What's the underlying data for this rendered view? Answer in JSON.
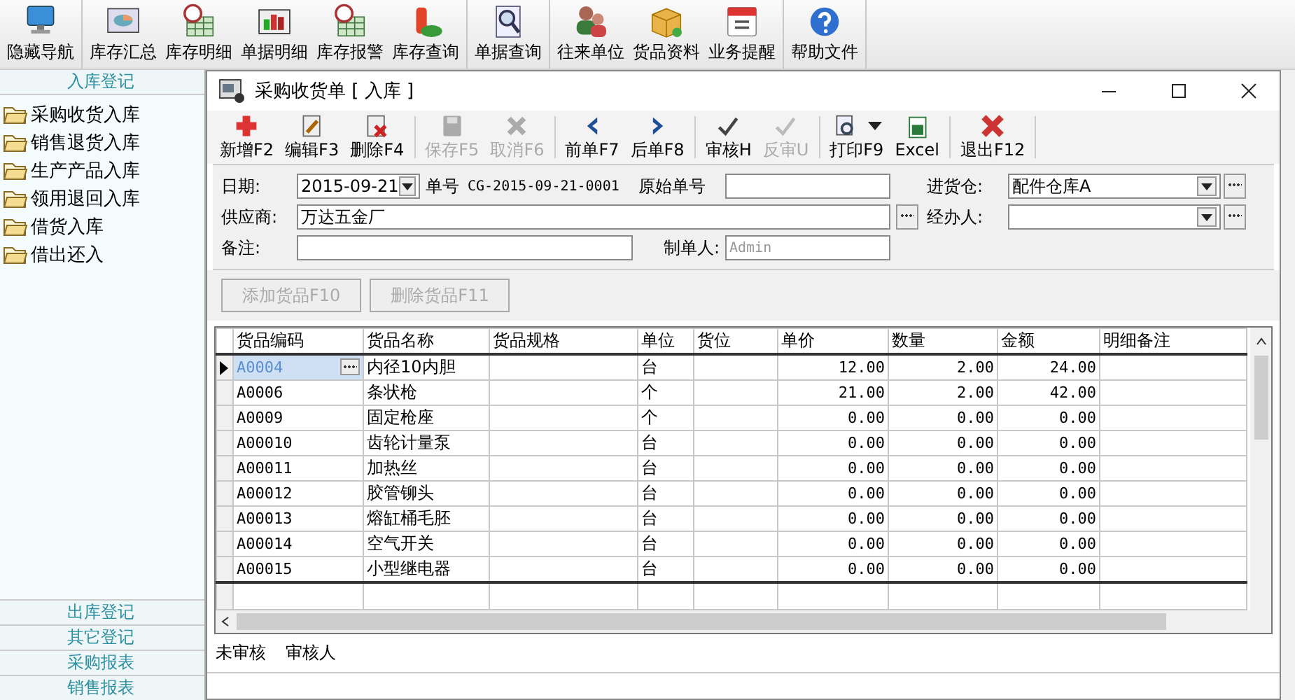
{
  "main_toolbar": [
    {
      "buttons": [
        "隐藏导航"
      ]
    },
    {
      "buttons": [
        "库存汇总",
        "库存明细",
        "单据明细",
        "库存报警",
        "库存查询"
      ]
    },
    {
      "buttons": [
        "单据查询"
      ]
    },
    {
      "buttons": [
        "往来单位",
        "货品资料",
        "业务提醒"
      ]
    },
    {
      "buttons": [
        "帮助文件"
      ]
    }
  ],
  "sidebar": {
    "header": "入库登记",
    "items": [
      {
        "label": "采购收货入库",
        "selected": false
      },
      {
        "label": "销售退货入库",
        "selected": false
      },
      {
        "label": "生产产品入库",
        "selected": false
      },
      {
        "label": "领用退回入库",
        "selected": false
      },
      {
        "label": "借货入库",
        "selected": false
      },
      {
        "label": "借出还入",
        "selected": false
      }
    ],
    "sections": [
      "出库登记",
      "其它登记",
      "采购报表",
      "销售报表"
    ]
  },
  "window": {
    "title": "采购收货单 [ 入库 ]"
  },
  "toolbar": [
    {
      "buttons": [
        {
          "label": "新增F2",
          "disabled": false,
          "has_menu": false
        },
        {
          "label": "编辑F3",
          "disabled": false,
          "has_menu": false
        },
        {
          "label": "删除F4",
          "disabled": false,
          "has_menu": false
        }
      ]
    },
    {
      "buttons": [
        {
          "label": "保存F5",
          "disabled": true,
          "has_menu": false
        },
        {
          "label": "取消F6",
          "disabled": true,
          "has_menu": false
        }
      ]
    },
    {
      "buttons": [
        {
          "label": "前单F7",
          "disabled": false,
          "has_menu": false
        },
        {
          "label": "后单F8",
          "disabled": false,
          "has_menu": false
        }
      ]
    },
    {
      "buttons": [
        {
          "label": "审核H",
          "disabled": false,
          "has_menu": false
        },
        {
          "label": "反审U",
          "disabled": true,
          "has_menu": false
        }
      ]
    },
    {
      "buttons": [
        {
          "label": "打印F9",
          "disabled": false,
          "has_menu": true
        },
        {
          "label": "Excel",
          "disabled": false,
          "has_menu": false
        }
      ]
    },
    {
      "buttons": [
        {
          "label": "退出F12",
          "disabled": false,
          "has_menu": false
        }
      ]
    }
  ],
  "form": {
    "date_label": "日期:",
    "date": "2015-09-21",
    "number_label": "单号",
    "number": "CG-2015-09-21-0001",
    "original_label": "原始单号",
    "warehouse_label": "进货仓:",
    "warehouse": "配件仓库A",
    "supplier_label": "供应商:",
    "supplier": "万达五金厂",
    "handler_label": "经办人:",
    "note_label": "备注:",
    "creator_label": "制单人:",
    "creator": "Admin"
  },
  "item_buttons": [
    {
      "label": "添加货品F10",
      "disabled": true
    },
    {
      "label": "删除货品F11",
      "disabled": true
    }
  ],
  "table": {
    "columns": [
      "货品编码",
      "货品名称",
      "货品规格",
      "单位",
      "货位",
      "单价",
      "数量",
      "金额",
      "明细备注"
    ],
    "rows": [
      {
        "selected": true,
        "cells": [
          "A0004",
          "内径10内胆",
          "",
          "台",
          "",
          "12.00",
          "2.00",
          "24.00",
          ""
        ]
      },
      {
        "selected": false,
        "cells": [
          "A0006",
          "条状枪",
          "",
          "个",
          "",
          "21.00",
          "2.00",
          "42.00",
          ""
        ]
      },
      {
        "selected": false,
        "cells": [
          "A0009",
          "固定枪座",
          "",
          "个",
          "",
          "0.00",
          "0.00",
          "0.00",
          ""
        ]
      },
      {
        "selected": false,
        "cells": [
          "A00010",
          "齿轮计量泵",
          "",
          "台",
          "",
          "0.00",
          "0.00",
          "0.00",
          ""
        ]
      },
      {
        "selected": false,
        "cells": [
          "A00011",
          "加热丝",
          "",
          "台",
          "",
          "0.00",
          "0.00",
          "0.00",
          ""
        ]
      },
      {
        "selected": false,
        "cells": [
          "A00012",
          "胶管铆头",
          "",
          "台",
          "",
          "0.00",
          "0.00",
          "0.00",
          ""
        ]
      },
      {
        "selected": false,
        "cells": [
          "A00013",
          "熔缸桶毛胚",
          "",
          "台",
          "",
          "0.00",
          "0.00",
          "0.00",
          ""
        ]
      },
      {
        "selected": false,
        "cells": [
          "A00014",
          "空气开关",
          "",
          "台",
          "",
          "0.00",
          "0.00",
          "0.00",
          ""
        ]
      },
      {
        "selected": false,
        "cells": [
          "A00015",
          "小型继电器",
          "",
          "台",
          "",
          "0.00",
          "0.00",
          "0.00",
          ""
        ]
      }
    ]
  },
  "status_bar": {
    "status": "未审核",
    "reviewer_label": "审核人"
  }
}
